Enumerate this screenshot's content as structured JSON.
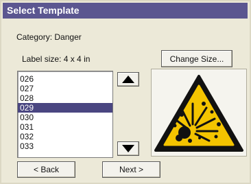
{
  "window": {
    "title": "Select Template"
  },
  "category": {
    "label": "Category:",
    "value": "Danger"
  },
  "label_size": {
    "label": "Label size:",
    "value": "4 x 4 in"
  },
  "buttons": {
    "change_size": "Change Size...",
    "back": "< Back",
    "next": "Next >"
  },
  "template_list": {
    "items": [
      "026",
      "027",
      "028",
      "029",
      "030",
      "031",
      "032",
      "033"
    ],
    "selected": "029"
  },
  "icons": {
    "scroll_up": "up-arrow-icon",
    "scroll_down": "down-arrow-icon",
    "preview": "explosive-hazard-icon"
  },
  "colors": {
    "title_bar": "#5b5690",
    "selection": "#4a4681",
    "warning_yellow": "#f4c400"
  }
}
